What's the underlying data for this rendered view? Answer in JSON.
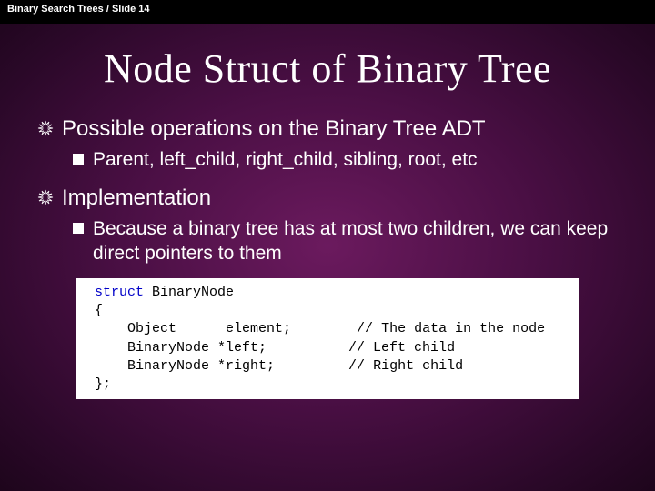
{
  "header": "Binary Search Trees / Slide 14",
  "title": "Node Struct of Binary Tree",
  "bullets": {
    "b1": {
      "text": "Possible operations on the Binary Tree ADT",
      "sub": "Parent, left_child, right_child, sibling, root, etc"
    },
    "b2": {
      "text": "Implementation",
      "sub": "Because a binary tree has at most two children, we can keep direct pointers to them"
    }
  },
  "code": {
    "kw_struct": "struct",
    "name": " BinaryNode",
    "open": "{",
    "l1a": "    Object      element;",
    "l1b": "        // The data in the node",
    "l2a": "    BinaryNode *left;",
    "l2b": "          // Left child",
    "l3a": "    BinaryNode *right;",
    "l3b": "         // Right child",
    "close": "};"
  }
}
